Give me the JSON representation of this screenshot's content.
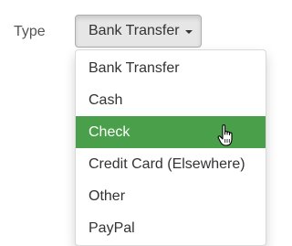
{
  "form": {
    "type_label": "Type"
  },
  "type_select": {
    "selected_value": "Bank Transfer",
    "options": [
      "Bank Transfer",
      "Cash",
      "Check",
      "Credit Card (Elsewhere)",
      "Other",
      "PayPal"
    ],
    "highlighted_index": 2
  },
  "colors": {
    "highlight": "#4aa04a",
    "button_active_bg": "#e6e6e6"
  },
  "icons": {
    "dropdown": "caret-down-icon",
    "pointer": "hand-pointer-icon"
  }
}
